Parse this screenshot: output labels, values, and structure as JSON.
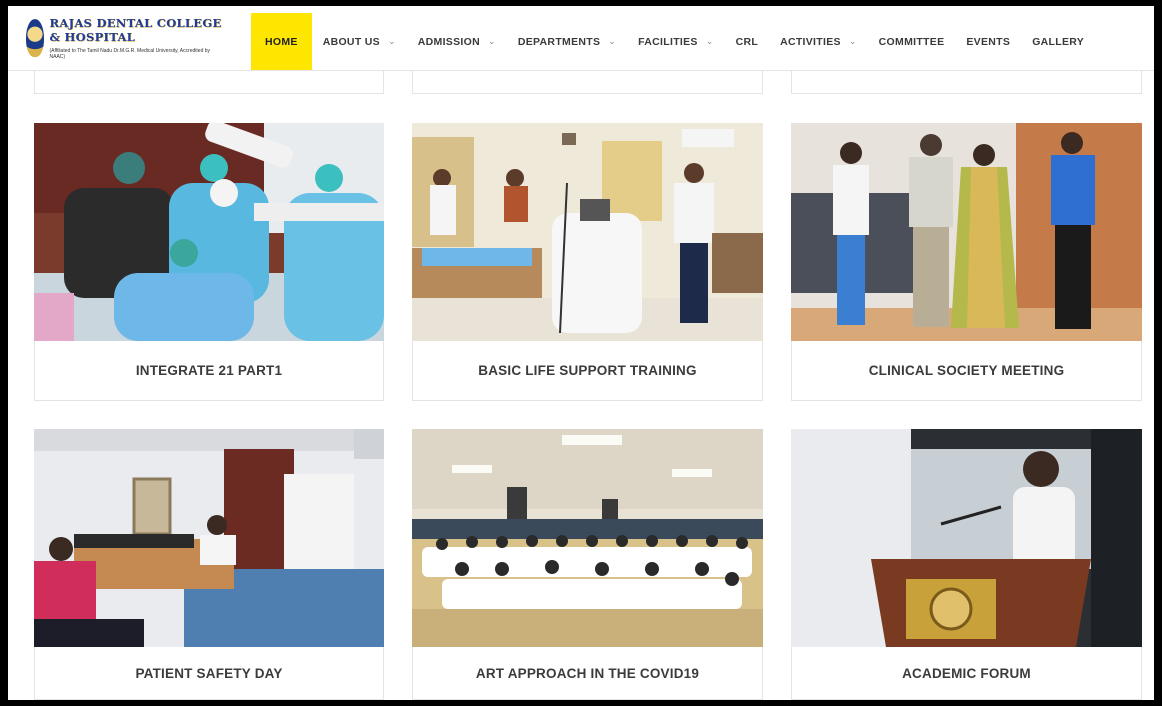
{
  "header": {
    "logo_name": "RAJAS DENTAL COLLEGE & HOSPITAL",
    "logo_sub": "(Affiliated to The Tamil Nadu Dr.M.G.R. Medical University, Accredited by NAAC)",
    "nav": [
      {
        "label": "HOME",
        "active": true,
        "dropdown": false
      },
      {
        "label": "ABOUT US",
        "active": false,
        "dropdown": true
      },
      {
        "label": "ADMISSION",
        "active": false,
        "dropdown": true
      },
      {
        "label": "DEPARTMENTS",
        "active": false,
        "dropdown": true
      },
      {
        "label": "FACILITIES",
        "active": false,
        "dropdown": true
      },
      {
        "label": "CRL",
        "active": false,
        "dropdown": false
      },
      {
        "label": "ACTIVITIES",
        "active": false,
        "dropdown": true
      },
      {
        "label": "COMMITTEE",
        "active": false,
        "dropdown": false
      },
      {
        "label": "EVENTS",
        "active": false,
        "dropdown": false
      },
      {
        "label": "GALLERY",
        "active": false,
        "dropdown": false
      }
    ],
    "chevron_icon": "chevron-down-icon",
    "active_color": "#ffe600"
  },
  "events": [
    {
      "title": "INTEGRATE 21 PART1"
    },
    {
      "title": "BASIC LIFE SUPPORT TRAINING"
    },
    {
      "title": "CLINICAL SOCIETY MEETING"
    },
    {
      "title": "PATIENT SAFETY DAY"
    },
    {
      "title": "ART APPROACH IN THE COVID19"
    },
    {
      "title": "ACADEMIC FORUM"
    }
  ]
}
